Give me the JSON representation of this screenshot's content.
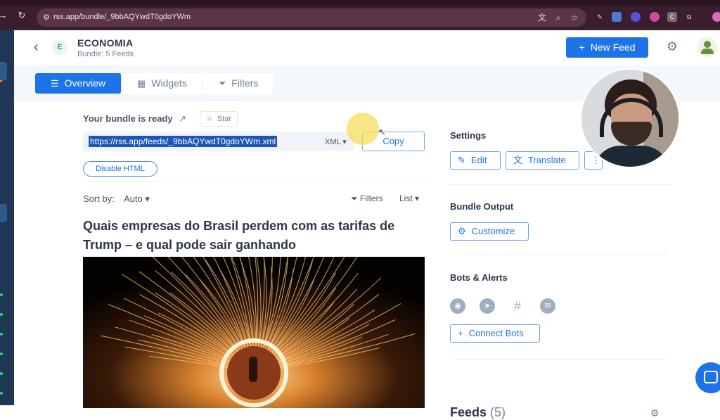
{
  "browser": {
    "url": "rss.app/bundle/_9bbAQYwdT0gdoYWm",
    "icons": [
      "back-icon",
      "reload-icon",
      "site-settings-icon",
      "translate-icon",
      "zoom-icon",
      "bookmark-star-icon",
      "pen-extension-icon",
      "extension-icon",
      "extension-icon",
      "extension-icon",
      "extension-icon",
      "puzzle-icon"
    ]
  },
  "header": {
    "back_icon": "chevron-left-icon",
    "badge_letter": "E",
    "title": "ECONOMIA",
    "subtitle": "Bundle: 5 Feeds",
    "new_feed_label": "New Feed",
    "new_feed_icon": "+"
  },
  "tabs": [
    {
      "label": "Overview",
      "icon": "lines-icon",
      "active": true
    },
    {
      "label": "Widgets",
      "icon": "grid-icon",
      "active": false
    },
    {
      "label": "Filters",
      "icon": "funnel-icon",
      "active": false
    }
  ],
  "main": {
    "ready_label": "Your bundle is ready",
    "star_label": "Star",
    "feed_url": "https://rss.app/feeds/_9bbAQYwdT0gdoYWm.xml",
    "format_label": "XML",
    "copy_label": "Copy",
    "disable_html_label": "Disable HTML",
    "sort_label": "Sort by:",
    "sort_value": "Auto",
    "filters_label": "Filters",
    "view_label": "List",
    "article_title": "Quais empresas do Brasil perdem com as tarifas de Trump – e qual pode sair ganhando"
  },
  "sidebar": {
    "settings_title": "Settings",
    "edit_label": "Edit",
    "translate_label": "Translate",
    "bundle_output_title": "Bundle Output",
    "customize_label": "Customize",
    "bots_title": "Bots & Alerts",
    "bots": [
      "discord-icon",
      "telegram-icon",
      "slack-icon",
      "email-icon"
    ],
    "connect_bots_label": "Connect Bots",
    "feeds_title": "Feeds",
    "feeds_count": "(5)"
  },
  "colors": {
    "accent": "#1d73e8",
    "chrome": "#3b1e2e",
    "left_rail": "#1f3655"
  }
}
